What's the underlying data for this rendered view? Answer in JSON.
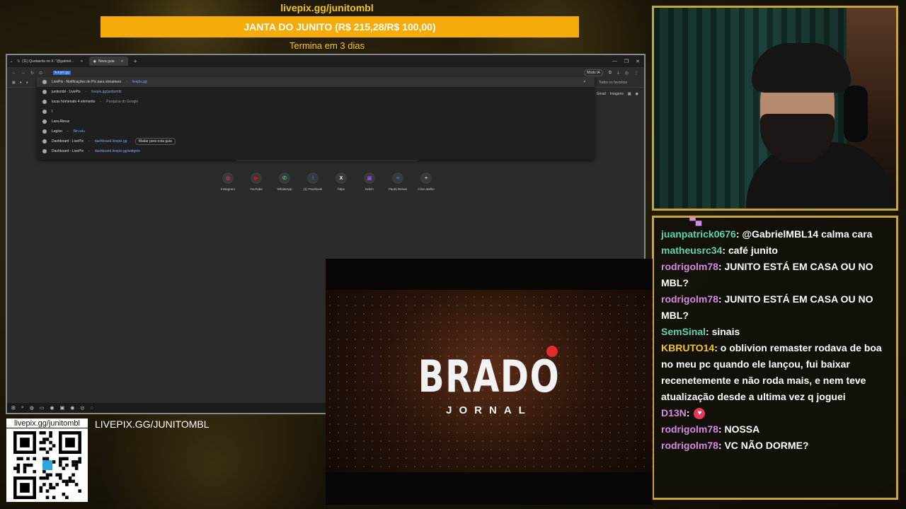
{
  "goal": {
    "url": "livepix.gg/junitombl",
    "title": "JANTA DO JUNITO (R$ 215,28/R$ 100,00)",
    "ends": "Termina em 3 dias"
  },
  "browser": {
    "tabs": [
      {
        "label": "(11) Quotasola no X: \"@gabriel..."
      },
      {
        "label": "Nova guia"
      }
    ],
    "omnibox_value": "livepix.gg",
    "modo_ia": "Modo IA",
    "bookmarks_right": "Todos os favoritos",
    "ntp_links": [
      "Gmail",
      "Imagens"
    ],
    "suggestions": [
      {
        "title": "LivePix - Notificações de Pix para streamers",
        "sep": " - ",
        "url": "livepix.gg",
        "extra": ""
      },
      {
        "title": "junitombl - LivePix",
        "sep": " - ",
        "url": "livepix.gg/junitombl",
        "extra": ""
      },
      {
        "title": "lucas homenato 4 elemento",
        "sep": " - ",
        "url": "",
        "extra": "Pesquisa do Google"
      },
      {
        "title": "l",
        "sep": "",
        "url": "",
        "extra": ""
      },
      {
        "title": "Lara Abeus",
        "sep": "",
        "url": "",
        "extra": ""
      },
      {
        "title": "Legion",
        "sep": " - ",
        "url": "Bin.wiu",
        "extra": ""
      },
      {
        "title": "Dashboard - LivePix",
        "sep": " - ",
        "url": "dashboard.livepix.gg",
        "extra": "Mudar para esta guia"
      },
      {
        "title": "Dashboard - LivePix",
        "sep": " - ",
        "url": "dashboard.livepix.gg/widgets",
        "extra": ""
      }
    ],
    "shortcuts": [
      {
        "label": "Instagram",
        "glyph": "◎",
        "color": "#e1306c"
      },
      {
        "label": "YouTube",
        "glyph": "▶",
        "color": "#ff0000"
      },
      {
        "label": "WhatsApp",
        "glyph": "✆",
        "color": "#25d366"
      },
      {
        "label": "(1) Facebook",
        "glyph": "f",
        "color": "#1877f2"
      },
      {
        "label": "https",
        "glyph": "X",
        "color": "#ffffff"
      },
      {
        "label": "twitch",
        "glyph": "▣",
        "color": "#9146ff"
      },
      {
        "label": "Pauta Renan",
        "glyph": "≡",
        "color": "#4285f4"
      },
      {
        "label": "Criar atalho",
        "glyph": "+",
        "color": "#cccccc"
      }
    ]
  },
  "qr": {
    "label": "livepix.gg/junitombl"
  },
  "livepix_banner": "LIVEPIX.GG/JUNITOMBL",
  "chat": {
    "messages": [
      {
        "user": "juanpatrick0676",
        "color": "#5fd3b3",
        "text": ": @GabrielMBL14 calma cara"
      },
      {
        "user": "matheusrc34",
        "color": "#5fd3b3",
        "text": ": café junito"
      },
      {
        "user": "rodrigolm78",
        "color": "#d58be3",
        "text": ": JUNITO ESTÁ EM CASA OU NO MBL?"
      },
      {
        "user": "rodrigolm78",
        "color": "#d58be3",
        "text": ": JUNITO ESTÁ EM CASA OU NO MBL?"
      },
      {
        "user": "SemSinal",
        "color": "#5fd3b3",
        "text": ": sinais"
      },
      {
        "user": "KBRUTO14",
        "color": "#f5c518",
        "text": ": o oblivion remaster rodava de boa no meu pc quando ele lançou, fui baixar recenetemente e não roda mais, e nem teve atualização desde a ultima vez q joguei"
      },
      {
        "user": "D13N",
        "color": "#d58be3",
        "text": ":"
      },
      {
        "user": "rodrigolm78",
        "color": "#d58be3",
        "text": ": NOSSA"
      },
      {
        "user": "rodrigolm78",
        "color": "#d58be3",
        "text": ": VC NÃO DORME?"
      }
    ]
  },
  "video": {
    "title": "BRADO",
    "subtitle": "JORNAL"
  }
}
